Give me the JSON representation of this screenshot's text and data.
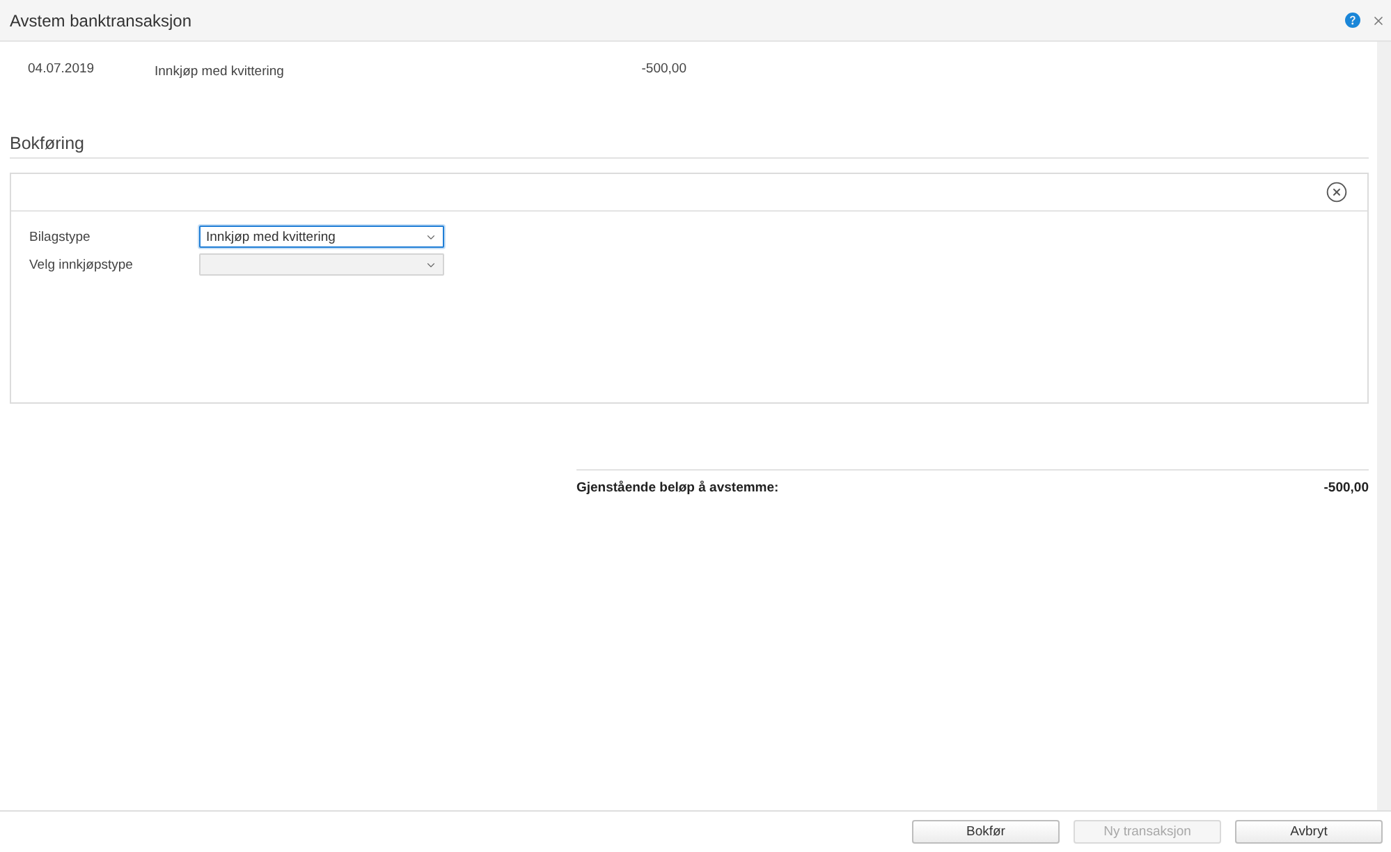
{
  "window": {
    "title": "Avstem banktransaksjon"
  },
  "transaction": {
    "date": "04.07.2019",
    "description": "Innkjøp med kvittering",
    "amount": "-500,00"
  },
  "section": {
    "title": "Bokføring"
  },
  "form": {
    "fields": [
      {
        "label": "Bilagstype",
        "value": "Innkjøp med kvittering",
        "focused": true
      },
      {
        "label": "Velg innkjøpstype",
        "focused": false
      }
    ]
  },
  "summary": {
    "label": "Gjenstående beløp å avstemme:",
    "amount": "-500,00"
  },
  "buttons": [
    {
      "label": "Bokfør",
      "disabled": false
    },
    {
      "label": "Ny transaksjon",
      "disabled": true
    },
    {
      "label": "Avbryt",
      "disabled": false
    }
  ]
}
